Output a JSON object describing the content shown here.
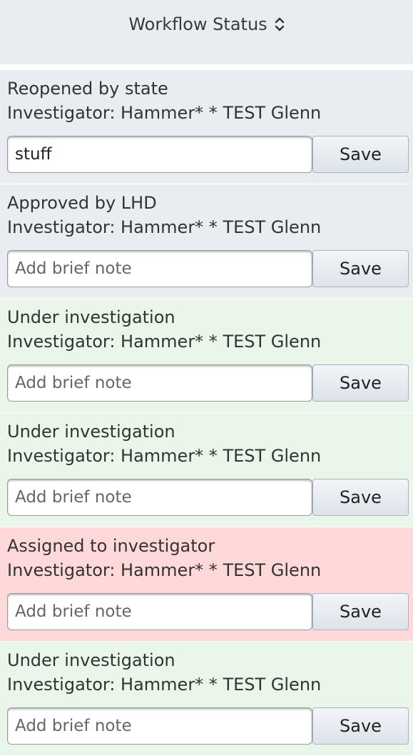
{
  "header": {
    "title": "Workflow Status",
    "sort_icon": "sort-updown-icon"
  },
  "rows": [
    {
      "status": "Reopened by state",
      "investigator": "Investigator: Hammer* * TEST Glenn",
      "note_value": "stuff",
      "note_placeholder": "Add brief note",
      "save_label": "Save",
      "tone": "gray"
    },
    {
      "status": "Approved by LHD",
      "investigator": "Investigator: Hammer* * TEST Glenn",
      "note_value": "",
      "note_placeholder": "Add brief note",
      "save_label": "Save",
      "tone": "gray"
    },
    {
      "status": "Under investigation",
      "investigator": "Investigator: Hammer* * TEST Glenn",
      "note_value": "",
      "note_placeholder": "Add brief note",
      "save_label": "Save",
      "tone": "green"
    },
    {
      "status": "Under investigation",
      "investigator": "Investigator: Hammer* * TEST Glenn",
      "note_value": "",
      "note_placeholder": "Add brief note",
      "save_label": "Save",
      "tone": "green"
    },
    {
      "status": "Assigned to investigator",
      "investigator": "Investigator: Hammer* * TEST Glenn",
      "note_value": "",
      "note_placeholder": "Add brief note",
      "save_label": "Save",
      "tone": "red"
    },
    {
      "status": "Under investigation",
      "investigator": "Investigator: Hammer* * TEST Glenn",
      "note_value": "",
      "note_placeholder": "Add brief note",
      "save_label": "Save",
      "tone": "green"
    }
  ],
  "colors": {
    "gray_row": "#e9edf2",
    "green_row": "#eaf6ea",
    "red_row": "#ffd9d9"
  }
}
